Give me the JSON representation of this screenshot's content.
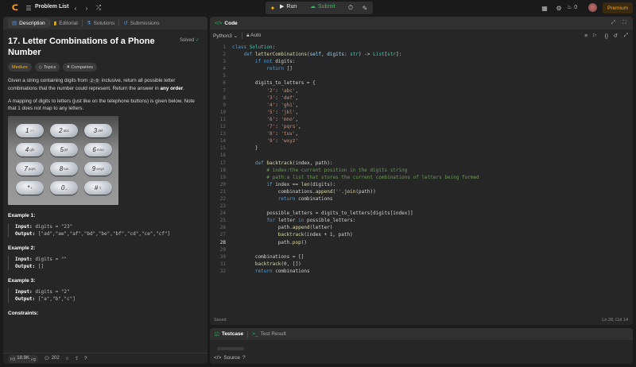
{
  "topbar": {
    "problem_list": "Problem List",
    "run": "Run",
    "submit": "Submit",
    "fire_count": "0",
    "premium": "Premium"
  },
  "left_tabs": [
    "Description",
    "Editorial",
    "Solutions",
    "Submissions"
  ],
  "problem": {
    "title": "17. Letter Combinations of a Phone Number",
    "status": "Solved",
    "difficulty": "Medium",
    "tags": [
      "Topics",
      "Companies"
    ],
    "p1_a": "Given a string containing digits from ",
    "p1_code": "2-9",
    "p1_b": " inclusive, return all possible letter combinations that the number could represent. Return the answer in ",
    "p1_bold": "any order",
    "p1_c": ".",
    "p2": "A mapping of digits to letters (just like on the telephone buttons) is given below. Note that 1 does not map to any letters.",
    "keys": [
      {
        "d": "1",
        "s": "○○"
      },
      {
        "d": "2",
        "s": "abc"
      },
      {
        "d": "3",
        "s": "def"
      },
      {
        "d": "4",
        "s": "ghi"
      },
      {
        "d": "5",
        "s": "jkl"
      },
      {
        "d": "6",
        "s": "mno"
      },
      {
        "d": "7",
        "s": "pqrs"
      },
      {
        "d": "8",
        "s": "tuv"
      },
      {
        "d": "9",
        "s": "wxyz"
      },
      {
        "d": "*",
        "s": "+"
      },
      {
        "d": "0",
        "s": "⎵"
      },
      {
        "d": "#",
        "s": "⇧"
      }
    ],
    "examples": [
      {
        "title": "Example 1:",
        "input": "digits = \"23\"",
        "output": "[\"ad\",\"ae\",\"af\",\"bd\",\"be\",\"bf\",\"cd\",\"ce\",\"cf\"]"
      },
      {
        "title": "Example 2:",
        "input": "digits = \"\"",
        "output": "[]"
      },
      {
        "title": "Example 3:",
        "input": "digits = \"2\"",
        "output": "[\"a\",\"b\",\"c\"]"
      }
    ],
    "input_label": "Input:",
    "output_label": "Output:",
    "constraints": "Constraints:"
  },
  "left_bottom": {
    "likes": "18.9K",
    "comments": "202"
  },
  "code_panel": {
    "title": "Code",
    "language": "Python3",
    "auto": "Auto",
    "status": "Saved",
    "cursor": "Ln 28, Col 14"
  },
  "test_panel": {
    "tab1": "Testcase",
    "tab2": "Test Result",
    "source": "Source"
  },
  "code_lines": [
    "<span class='kw'>class</span> <span class='ty'>Solution</span>:",
    "    <span class='kw'>def</span> <span class='fn'>letterCombinations</span>(<span class='pr'>self</span>, <span class='pr'>digits</span>: <span class='ty'>str</span>) -> <span class='ty'>List</span>[<span class='ty'>str</span>]:",
    "        <span class='kw'>if not</span> digits:",
    "            <span class='kw'>return</span> []",
    "",
    "        digits_to_letters = {",
    "            <span class='str'>'2'</span>: <span class='str'>'abc'</span>,",
    "            <span class='str'>'3'</span>: <span class='str'>'def'</span>,",
    "            <span class='str'>'4'</span>: <span class='str'>'ghi'</span>,",
    "            <span class='str'>'5'</span>: <span class='str'>'jkl'</span>,",
    "            <span class='str'>'6'</span>: <span class='str'>'mno'</span>,",
    "            <span class='str'>'7'</span>: <span class='str'>'pqrs'</span>,",
    "            <span class='str'>'8'</span>: <span class='str'>'tuv'</span>,",
    "            <span class='str'>'9'</span>: <span class='str'>'wxyz'</span>",
    "        }",
    "",
    "        <span class='kw'>def</span> <span class='fn'>backtrack</span>(index, path):",
    "            <span class='cm'># index:the current position in the digits string</span>",
    "            <span class='cm'># path:a list that stores the current combinations of letters being formed</span>",
    "            <span class='kw'>if</span> index == <span class='fn'>len</span>(digits):",
    "                combinations.<span class='fn'>append</span>(<span class='str'>''</span>.<span class='fn'>join</span>(path))",
    "                <span class='kw'>return</span> combinations",
    "",
    "            possible_letters = digits_to_letters[digits[index]]",
    "            <span class='kw'>for</span> letter <span class='kw'>in</span> possible_letters:",
    "                path.<span class='fn'>append</span>(letter)",
    "                <span class='fn'>backtrack</span>(index + 1, path)",
    "                path.<span class='fn'>pop</span>()",
    "",
    "        combinations = []",
    "        <span class='fn'>backtrack</span>(0, [])",
    "        <span class='kw'>return</span> combinations"
  ]
}
